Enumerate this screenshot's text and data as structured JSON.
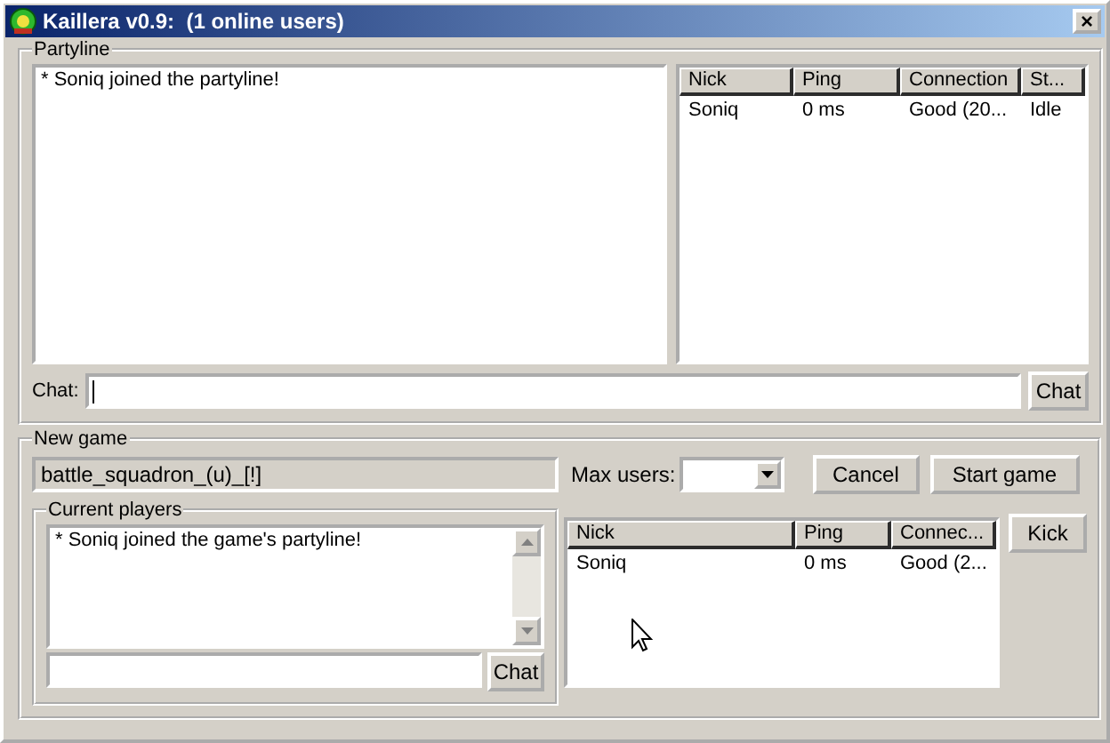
{
  "window": {
    "title": "Kaillera v0.9:  (1 online users)",
    "close": "×"
  },
  "partyline": {
    "title": "Partyline",
    "messages": [
      "* Soniq joined the partyline!"
    ],
    "columns": [
      "Nick",
      "Ping",
      "Connection",
      "St..."
    ],
    "rows": [
      [
        "Soniq",
        "0 ms",
        "Good (20...",
        "Idle"
      ]
    ],
    "chat_label": "Chat:",
    "chat_button": "Chat"
  },
  "new_game": {
    "title": "New game",
    "game_name": "battle_squadron_(u)_[!]",
    "max_users_label": "Max users:",
    "buttons": [
      "Cancel",
      "Start game"
    ],
    "current_players": {
      "title": "Current players",
      "messages": [
        "* Soniq joined the game's partyline!"
      ],
      "chat_button": "Chat",
      "columns": [
        "Nick",
        "Ping",
        "Connec..."
      ],
      "rows": [
        [
          "Soniq",
          "0 ms",
          "Good (2..."
        ]
      ]
    },
    "kick_button": "Kick"
  }
}
